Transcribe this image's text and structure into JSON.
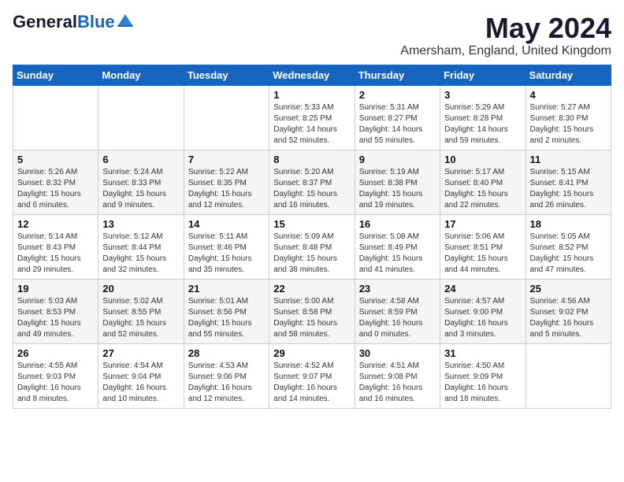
{
  "header": {
    "logo_general": "General",
    "logo_blue": "Blue",
    "month_year": "May 2024",
    "location": "Amersham, England, United Kingdom"
  },
  "weekdays": [
    "Sunday",
    "Monday",
    "Tuesday",
    "Wednesday",
    "Thursday",
    "Friday",
    "Saturday"
  ],
  "weeks": [
    [
      {
        "day": "",
        "content": ""
      },
      {
        "day": "",
        "content": ""
      },
      {
        "day": "",
        "content": ""
      },
      {
        "day": "1",
        "content": "Sunrise: 5:33 AM\nSunset: 8:25 PM\nDaylight: 14 hours and 52 minutes."
      },
      {
        "day": "2",
        "content": "Sunrise: 5:31 AM\nSunset: 8:27 PM\nDaylight: 14 hours and 55 minutes."
      },
      {
        "day": "3",
        "content": "Sunrise: 5:29 AM\nSunset: 8:28 PM\nDaylight: 14 hours and 59 minutes."
      },
      {
        "day": "4",
        "content": "Sunrise: 5:27 AM\nSunset: 8:30 PM\nDaylight: 15 hours and 2 minutes."
      }
    ],
    [
      {
        "day": "5",
        "content": "Sunrise: 5:26 AM\nSunset: 8:32 PM\nDaylight: 15 hours and 6 minutes."
      },
      {
        "day": "6",
        "content": "Sunrise: 5:24 AM\nSunset: 8:33 PM\nDaylight: 15 hours and 9 minutes."
      },
      {
        "day": "7",
        "content": "Sunrise: 5:22 AM\nSunset: 8:35 PM\nDaylight: 15 hours and 12 minutes."
      },
      {
        "day": "8",
        "content": "Sunrise: 5:20 AM\nSunset: 8:37 PM\nDaylight: 15 hours and 16 minutes."
      },
      {
        "day": "9",
        "content": "Sunrise: 5:19 AM\nSunset: 8:38 PM\nDaylight: 15 hours and 19 minutes."
      },
      {
        "day": "10",
        "content": "Sunrise: 5:17 AM\nSunset: 8:40 PM\nDaylight: 15 hours and 22 minutes."
      },
      {
        "day": "11",
        "content": "Sunrise: 5:15 AM\nSunset: 8:41 PM\nDaylight: 15 hours and 26 minutes."
      }
    ],
    [
      {
        "day": "12",
        "content": "Sunrise: 5:14 AM\nSunset: 8:43 PM\nDaylight: 15 hours and 29 minutes."
      },
      {
        "day": "13",
        "content": "Sunrise: 5:12 AM\nSunset: 8:44 PM\nDaylight: 15 hours and 32 minutes."
      },
      {
        "day": "14",
        "content": "Sunrise: 5:11 AM\nSunset: 8:46 PM\nDaylight: 15 hours and 35 minutes."
      },
      {
        "day": "15",
        "content": "Sunrise: 5:09 AM\nSunset: 8:48 PM\nDaylight: 15 hours and 38 minutes."
      },
      {
        "day": "16",
        "content": "Sunrise: 5:08 AM\nSunset: 8:49 PM\nDaylight: 15 hours and 41 minutes."
      },
      {
        "day": "17",
        "content": "Sunrise: 5:06 AM\nSunset: 8:51 PM\nDaylight: 15 hours and 44 minutes."
      },
      {
        "day": "18",
        "content": "Sunrise: 5:05 AM\nSunset: 8:52 PM\nDaylight: 15 hours and 47 minutes."
      }
    ],
    [
      {
        "day": "19",
        "content": "Sunrise: 5:03 AM\nSunset: 8:53 PM\nDaylight: 15 hours and 49 minutes."
      },
      {
        "day": "20",
        "content": "Sunrise: 5:02 AM\nSunset: 8:55 PM\nDaylight: 15 hours and 52 minutes."
      },
      {
        "day": "21",
        "content": "Sunrise: 5:01 AM\nSunset: 8:56 PM\nDaylight: 15 hours and 55 minutes."
      },
      {
        "day": "22",
        "content": "Sunrise: 5:00 AM\nSunset: 8:58 PM\nDaylight: 15 hours and 58 minutes."
      },
      {
        "day": "23",
        "content": "Sunrise: 4:58 AM\nSunset: 8:59 PM\nDaylight: 16 hours and 0 minutes."
      },
      {
        "day": "24",
        "content": "Sunrise: 4:57 AM\nSunset: 9:00 PM\nDaylight: 16 hours and 3 minutes."
      },
      {
        "day": "25",
        "content": "Sunrise: 4:56 AM\nSunset: 9:02 PM\nDaylight: 16 hours and 5 minutes."
      }
    ],
    [
      {
        "day": "26",
        "content": "Sunrise: 4:55 AM\nSunset: 9:03 PM\nDaylight: 16 hours and 8 minutes."
      },
      {
        "day": "27",
        "content": "Sunrise: 4:54 AM\nSunset: 9:04 PM\nDaylight: 16 hours and 10 minutes."
      },
      {
        "day": "28",
        "content": "Sunrise: 4:53 AM\nSunset: 9:06 PM\nDaylight: 16 hours and 12 minutes."
      },
      {
        "day": "29",
        "content": "Sunrise: 4:52 AM\nSunset: 9:07 PM\nDaylight: 16 hours and 14 minutes."
      },
      {
        "day": "30",
        "content": "Sunrise: 4:51 AM\nSunset: 9:08 PM\nDaylight: 16 hours and 16 minutes."
      },
      {
        "day": "31",
        "content": "Sunrise: 4:50 AM\nSunset: 9:09 PM\nDaylight: 16 hours and 18 minutes."
      },
      {
        "day": "",
        "content": ""
      }
    ]
  ]
}
